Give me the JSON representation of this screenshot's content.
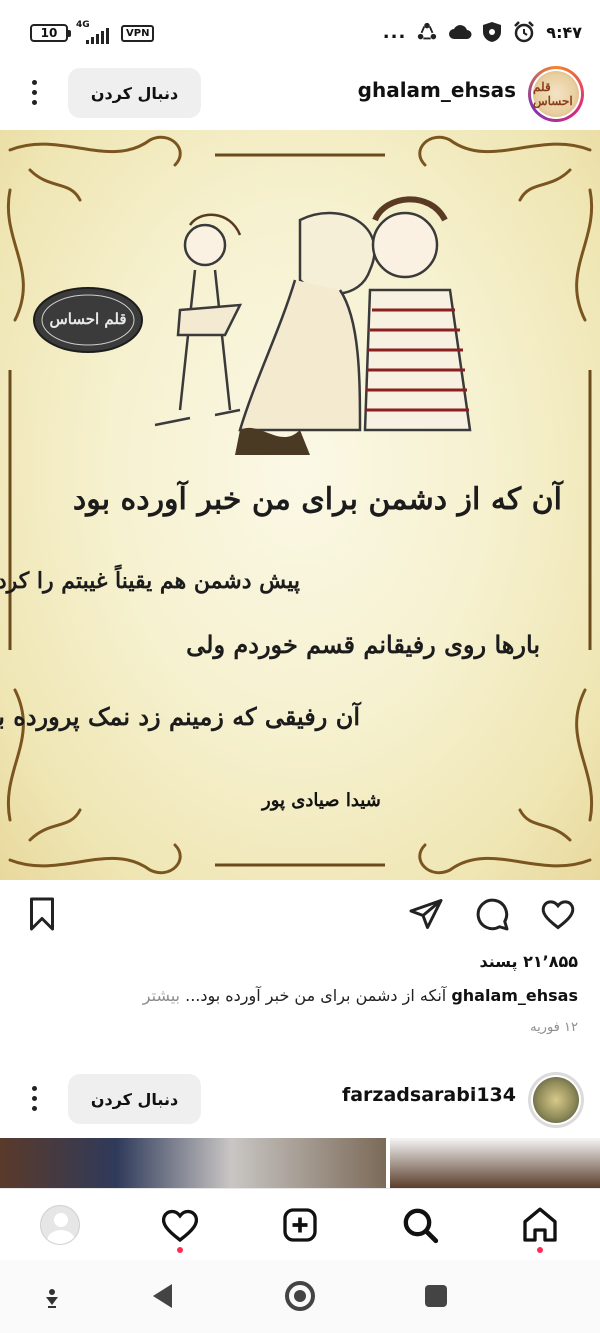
{
  "status_bar": {
    "battery": "10",
    "network": "4G",
    "vpn": "VPN",
    "time": "۹:۴۷",
    "overflow": "..."
  },
  "posts": [
    {
      "username": "ghalam_ehsas",
      "avatar_text": "قلم احساس",
      "follow_label": "دنبال کردن",
      "image": {
        "logo_text": "قلم احساس",
        "poem_lines": [
          "آن که از دشمن برای من خبر آورده بود",
          "پیش دشمن هم یقیناً غیبتم را کرده بود",
          "بارها روی رفیقانم قسم خوردم ولی",
          "آن رفیقی که زمینم زد نمک پرورده بود"
        ],
        "signature": "شیدا صیادی پور"
      },
      "likes": "۲۱٬۸۵۵ پسند",
      "caption_user": "ghalam_ehsas",
      "caption_text": "آنکه از دشمن برای من خبر آورده بود...",
      "caption_more": "بیشتر",
      "date": "۱۲ فوریه",
      "icons": [
        "heart-icon",
        "comment-icon",
        "share-icon",
        "bookmark-icon"
      ]
    },
    {
      "username": "farzadsarabi134",
      "follow_label": "دنبال کردن"
    }
  ],
  "bottom_nav": [
    "home-icon",
    "search-icon",
    "create-icon",
    "activity-icon",
    "profile-icon"
  ],
  "colors": {
    "accent_dot": "#ff2d55",
    "follow_bg": "#efefef",
    "muted_text": "#8e8e8e"
  }
}
